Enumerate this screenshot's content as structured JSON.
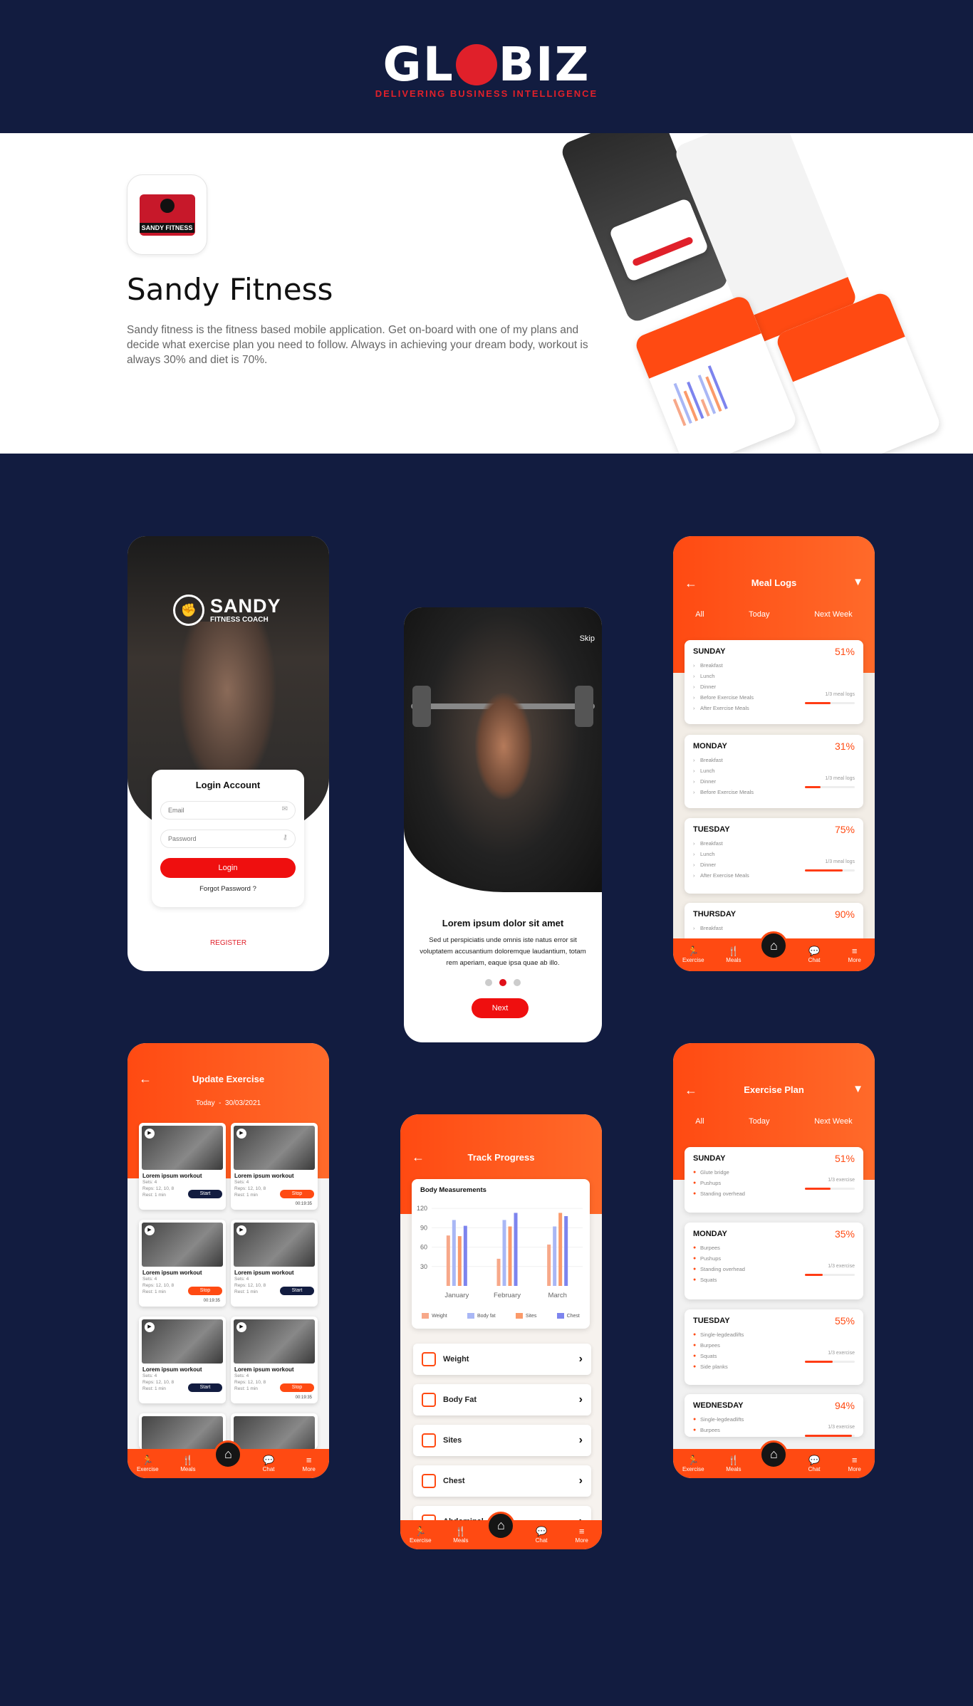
{
  "brand": {
    "name_left": "GL",
    "name_right": "BIZ",
    "tagline": "DELIVERING   BUSINESS   INTELLIGENCE"
  },
  "app": {
    "icon_line1": "SANDY FITNESS",
    "title": "Sandy Fitness",
    "description": "Sandy fitness is the fitness based mobile application. Get on-board with one of my plans and decide what exercise plan you need to follow. Always in achieving your dream body, workout is always 30% and diet is 70%."
  },
  "login": {
    "brand_line1": "SANDY",
    "brand_line2": "FITNESS COACH",
    "title": "Login Account",
    "email_placeholder": "Email",
    "password_placeholder": "Password",
    "login_label": "Login",
    "forgot_label": "Forgot Password ?",
    "register_label": "REGISTER"
  },
  "onboard": {
    "skip": "Skip",
    "heading": "Lorem ipsum dolor sit amet",
    "body": "Sed ut perspiciatis unde omnis iste natus error sit voluptatem accusantium doloremque laudantium, totam rem aperiam, eaque ipsa quae ab illo.",
    "next": "Next"
  },
  "nav": {
    "exercise": "Exercise",
    "meals": "Meals",
    "chat": "Chat",
    "more": "More"
  },
  "meal_logs": {
    "title": "Meal Logs",
    "tabs": [
      "All",
      "Today",
      "Next Week"
    ],
    "days": [
      {
        "day": "SUNDAY",
        "pct": "51%",
        "progress": 51,
        "logs": "1/3 meal logs",
        "items": [
          "Breakfast",
          "Lunch",
          "Dinner",
          "Before Exercise Meals",
          "After Exercise Meals"
        ]
      },
      {
        "day": "MONDAY",
        "pct": "31%",
        "progress": 31,
        "logs": "1/3 meal logs",
        "items": [
          "Breakfast",
          "Lunch",
          "Dinner",
          "Before Exercise Meals"
        ]
      },
      {
        "day": "TUESDAY",
        "pct": "75%",
        "progress": 75,
        "logs": "1/3 meal logs",
        "items": [
          "Breakfast",
          "Lunch",
          "Dinner",
          "After Exercise Meals"
        ]
      },
      {
        "day": "THURSDAY",
        "pct": "90%",
        "progress": 90,
        "logs": "",
        "items": [
          "Breakfast"
        ]
      }
    ]
  },
  "update_exercise": {
    "title": "Update Exercise",
    "date": "Today  -  30/03/2021",
    "cards": [
      {
        "title": "Lorem ipsum workout",
        "meta": [
          "Sets: 4",
          "Reps: 12, 10, 8",
          "Rest: 1 min"
        ],
        "btn": "Start",
        "state": "start",
        "time": ""
      },
      {
        "title": "Lorem ipsum workout",
        "meta": [
          "Sets: 4",
          "Reps: 12, 10, 8",
          "Rest: 1 min"
        ],
        "btn": "Stop",
        "state": "stop",
        "time": "00:19:35"
      },
      {
        "title": "Lorem ipsum workout",
        "meta": [
          "Sets: 4",
          "Reps: 12, 10, 8",
          "Rest: 1 min"
        ],
        "btn": "Stop",
        "state": "stop",
        "time": "00:19:35"
      },
      {
        "title": "Lorem ipsum workout",
        "meta": [
          "Sets: 4",
          "Reps: 12, 10, 8",
          "Rest: 1 min"
        ],
        "btn": "Start",
        "state": "start",
        "time": ""
      },
      {
        "title": "Lorem ipsum workout",
        "meta": [
          "Sets: 4",
          "Reps: 12, 10, 8",
          "Rest: 1 min"
        ],
        "btn": "Start",
        "state": "start",
        "time": ""
      },
      {
        "title": "Lorem ipsum workout",
        "meta": [
          "Sets: 4",
          "Reps: 12, 10, 8",
          "Rest: 1 min"
        ],
        "btn": "Stop",
        "state": "stop",
        "time": "00:19:35"
      }
    ]
  },
  "track": {
    "title": "Track Progress",
    "chart_title": "Body Measurements",
    "items": [
      "Weight",
      "Body Fat",
      "Sites",
      "Chest",
      "Abdominal"
    ]
  },
  "chart_data": {
    "type": "bar",
    "title": "Body Measurements",
    "categories": [
      "January",
      "February",
      "March"
    ],
    "yticks": [
      120,
      90,
      60,
      30
    ],
    "ylim": [
      0,
      130
    ],
    "series": [
      {
        "name": "Weight",
        "color": "#f7a889",
        "values": [
          78,
          42,
          64
        ]
      },
      {
        "name": "Body fat",
        "color": "#a9b7f5",
        "values": [
          102,
          102,
          92
        ]
      },
      {
        "name": "Sites",
        "color": "#fb9a6a",
        "values": [
          77,
          92,
          113
        ]
      },
      {
        "name": "Chest",
        "color": "#7d84ee",
        "values": [
          93,
          113,
          108
        ]
      }
    ]
  },
  "exercise_plan": {
    "title": "Exercise Plan",
    "tabs": [
      "All",
      "Today",
      "Next Week"
    ],
    "days": [
      {
        "day": "SUNDAY",
        "pct": "51%",
        "progress": 51,
        "logs": "1/3 exercise",
        "items": [
          "Glute bridge",
          "Pushups",
          "Standing overhead"
        ]
      },
      {
        "day": "MONDAY",
        "pct": "35%",
        "progress": 35,
        "logs": "1/3 exercise",
        "items": [
          "Burpees",
          "Pushups",
          "Standing overhead",
          "Squats"
        ]
      },
      {
        "day": "TUESDAY",
        "pct": "55%",
        "progress": 55,
        "logs": "1/3 exercise",
        "items": [
          "Single-legdeadlifts",
          "Burpees",
          "Squats",
          "Side planks"
        ]
      },
      {
        "day": "WEDNESDAY",
        "pct": "94%",
        "progress": 94,
        "logs": "1/3 exercise",
        "items": [
          "Single-legdeadlifts",
          "Burpees"
        ]
      }
    ]
  },
  "colors": {
    "navy": "#121c40",
    "accent": "#ff4a12",
    "red": "#e0202a"
  }
}
